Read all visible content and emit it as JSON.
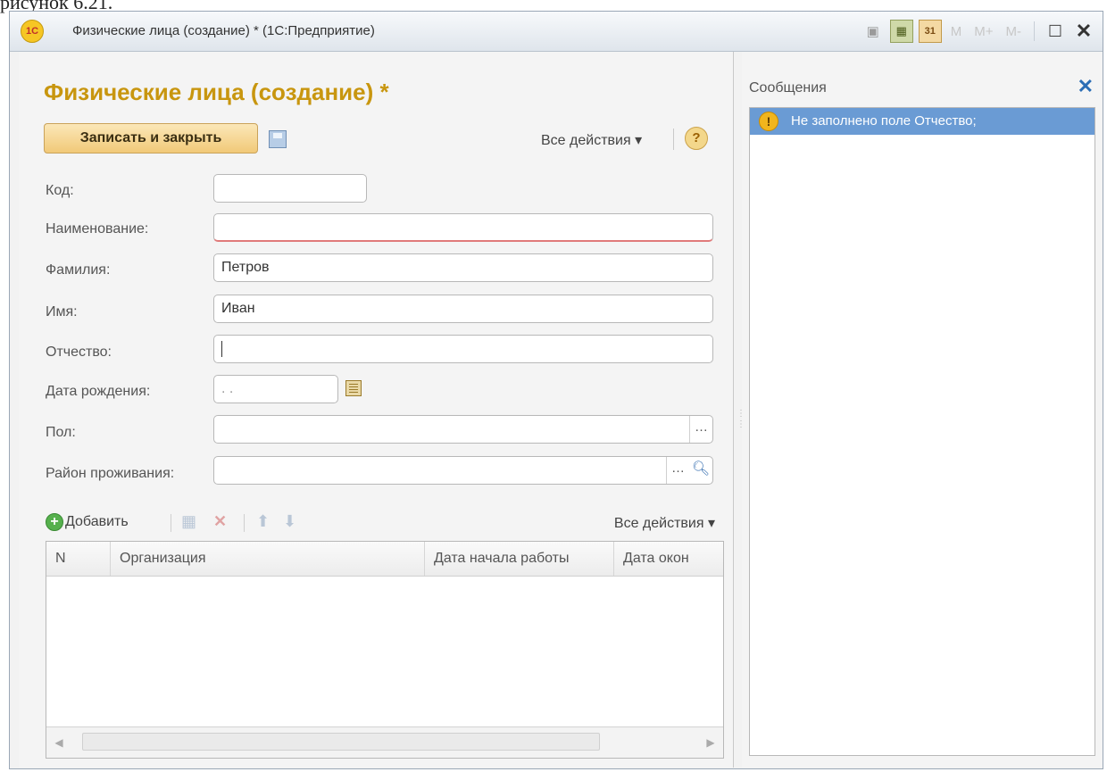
{
  "caption": "рисунок 6.21.",
  "window": {
    "logo": "1С",
    "title": "Физические лица (создание) * (1С:Предприятие)",
    "toolbar_m": "M",
    "toolbar_mplus": "M+",
    "toolbar_mminus": "M-",
    "calendar_day": "31"
  },
  "form": {
    "title": "Физические лица (создание) *",
    "write_close": "Записать и закрыть",
    "all_actions": "Все действия ▾",
    "help": "?",
    "fields": {
      "code": {
        "label": "Код:",
        "value": ""
      },
      "name": {
        "label": "Наименование:",
        "value": ""
      },
      "surname": {
        "label": "Фамилия:",
        "value": "Петров"
      },
      "firstname": {
        "label": "Имя:",
        "value": "Иван"
      },
      "patronymic": {
        "label": "Отчество:",
        "value": ""
      },
      "birthdate": {
        "label": "Дата рождения:",
        "value": " .  . "
      },
      "gender": {
        "label": "Пол:",
        "value": ""
      },
      "district": {
        "label": "Район проживания:",
        "value": ""
      }
    },
    "table_toolbar": {
      "add": "Добавить",
      "all_actions": "Все действия ▾"
    },
    "table_columns": [
      "N",
      "Организация",
      "Дата начала работы",
      "Дата окон"
    ]
  },
  "messages": {
    "title": "Сообщения",
    "items": [
      {
        "text": "Не заполнено поле Отчество;"
      }
    ]
  }
}
